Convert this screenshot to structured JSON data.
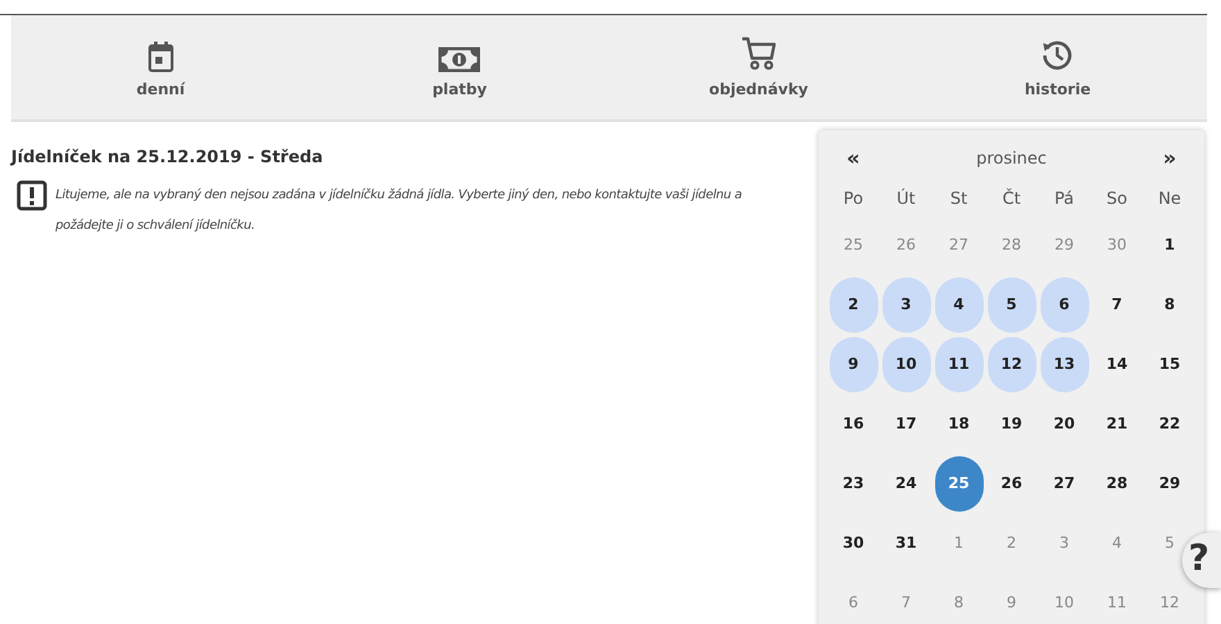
{
  "nav": [
    {
      "label": "denní"
    },
    {
      "label": "platby"
    },
    {
      "label": "objednávky"
    },
    {
      "label": "historie"
    }
  ],
  "menu": {
    "title": "Jídelníček na 25.12.2019 - Středa",
    "message": "Litujeme, ale na vybraný den nejsou zadána v jídelníčku žádná jídla. Vyberte jiný den, nebo kontaktujte vaši jídelnu a požádejte ji o schválení jídelníčku."
  },
  "calendar": {
    "prev": "«",
    "month": "prosinec",
    "next": "»",
    "weekdays": [
      "Po",
      "Út",
      "St",
      "Čt",
      "Pá",
      "So",
      "Ne"
    ],
    "weeks": [
      [
        {
          "day": "25",
          "kind": "other",
          "selected": false
        },
        {
          "day": "26",
          "kind": "other",
          "selected": false
        },
        {
          "day": "27",
          "kind": "other",
          "selected": false
        },
        {
          "day": "28",
          "kind": "other",
          "selected": false
        },
        {
          "day": "29",
          "kind": "other",
          "selected": false
        },
        {
          "day": "30",
          "kind": "other",
          "selected": false
        },
        {
          "day": "1",
          "kind": "plain",
          "selected": false
        }
      ],
      [
        {
          "day": "2",
          "kind": "ordered",
          "selected": false
        },
        {
          "day": "3",
          "kind": "ordered",
          "selected": false
        },
        {
          "day": "4",
          "kind": "ordered",
          "selected": false
        },
        {
          "day": "5",
          "kind": "ordered",
          "selected": false
        },
        {
          "day": "6",
          "kind": "ordered",
          "selected": false
        },
        {
          "day": "7",
          "kind": "plain",
          "selected": false
        },
        {
          "day": "8",
          "kind": "plain",
          "selected": false
        }
      ],
      [
        {
          "day": "9",
          "kind": "ordered",
          "selected": false
        },
        {
          "day": "10",
          "kind": "ordered",
          "selected": false
        },
        {
          "day": "11",
          "kind": "ordered",
          "selected": false
        },
        {
          "day": "12",
          "kind": "ordered",
          "selected": false
        },
        {
          "day": "13",
          "kind": "ordered",
          "selected": false
        },
        {
          "day": "14",
          "kind": "plain",
          "selected": false
        },
        {
          "day": "15",
          "kind": "plain",
          "selected": false
        }
      ],
      [
        {
          "day": "16",
          "kind": "plain",
          "selected": false
        },
        {
          "day": "17",
          "kind": "plain",
          "selected": false
        },
        {
          "day": "18",
          "kind": "plain",
          "selected": false
        },
        {
          "day": "19",
          "kind": "plain",
          "selected": false
        },
        {
          "day": "20",
          "kind": "plain",
          "selected": false
        },
        {
          "day": "21",
          "kind": "plain",
          "selected": false
        },
        {
          "day": "22",
          "kind": "plain",
          "selected": false
        }
      ],
      [
        {
          "day": "23",
          "kind": "plain",
          "selected": false
        },
        {
          "day": "24",
          "kind": "plain",
          "selected": false
        },
        {
          "day": "25",
          "kind": "plain",
          "selected": true
        },
        {
          "day": "26",
          "kind": "plain",
          "selected": false
        },
        {
          "day": "27",
          "kind": "plain",
          "selected": false
        },
        {
          "day": "28",
          "kind": "plain",
          "selected": false
        },
        {
          "day": "29",
          "kind": "plain",
          "selected": false
        }
      ],
      [
        {
          "day": "30",
          "kind": "plain",
          "selected": false
        },
        {
          "day": "31",
          "kind": "plain",
          "selected": false
        },
        {
          "day": "1",
          "kind": "other",
          "selected": false
        },
        {
          "day": "2",
          "kind": "other",
          "selected": false
        },
        {
          "day": "3",
          "kind": "other",
          "selected": false
        },
        {
          "day": "4",
          "kind": "other",
          "selected": false
        },
        {
          "day": "5",
          "kind": "other",
          "selected": false
        }
      ],
      [
        {
          "day": "6",
          "kind": "other",
          "selected": false
        },
        {
          "day": "7",
          "kind": "other",
          "selected": false
        },
        {
          "day": "8",
          "kind": "other",
          "selected": false
        },
        {
          "day": "9",
          "kind": "other",
          "selected": false
        },
        {
          "day": "10",
          "kind": "other",
          "selected": false
        },
        {
          "day": "11",
          "kind": "other",
          "selected": false
        },
        {
          "day": "12",
          "kind": "other",
          "selected": false
        }
      ]
    ]
  },
  "help": {
    "label": "?"
  }
}
